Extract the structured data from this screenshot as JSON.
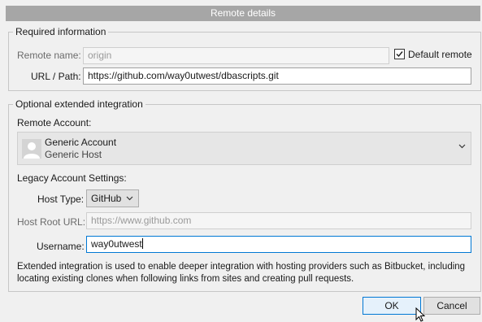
{
  "window": {
    "title": "Remote details"
  },
  "required": {
    "legend": "Required information",
    "remote_name_label": "Remote name:",
    "remote_name_value": "origin",
    "default_remote_label": "Default remote",
    "default_remote_checked": true,
    "url_label": "URL / Path:",
    "url_value": "https://github.com/way0utwest/dbascripts.git"
  },
  "optional": {
    "legend": "Optional extended integration",
    "remote_account_label": "Remote Account:",
    "account": {
      "name": "Generic Account",
      "subtitle": "Generic Host"
    },
    "legacy_label": "Legacy Account Settings:",
    "host_type_label": "Host Type:",
    "host_type_value": "GitHub",
    "host_root_label": "Host Root URL:",
    "host_root_placeholder": "https://www.github.com",
    "username_label": "Username:",
    "username_value": "way0utwest",
    "info_text": "Extended integration is used to enable deeper integration with hosting providers such as Bitbucket, including locating existing clones when following links from sites and creating pull requests."
  },
  "buttons": {
    "ok": "OK",
    "cancel": "Cancel"
  },
  "colors": {
    "focus_accent": "#0078d4",
    "titlebar": "#a6a6a6"
  }
}
